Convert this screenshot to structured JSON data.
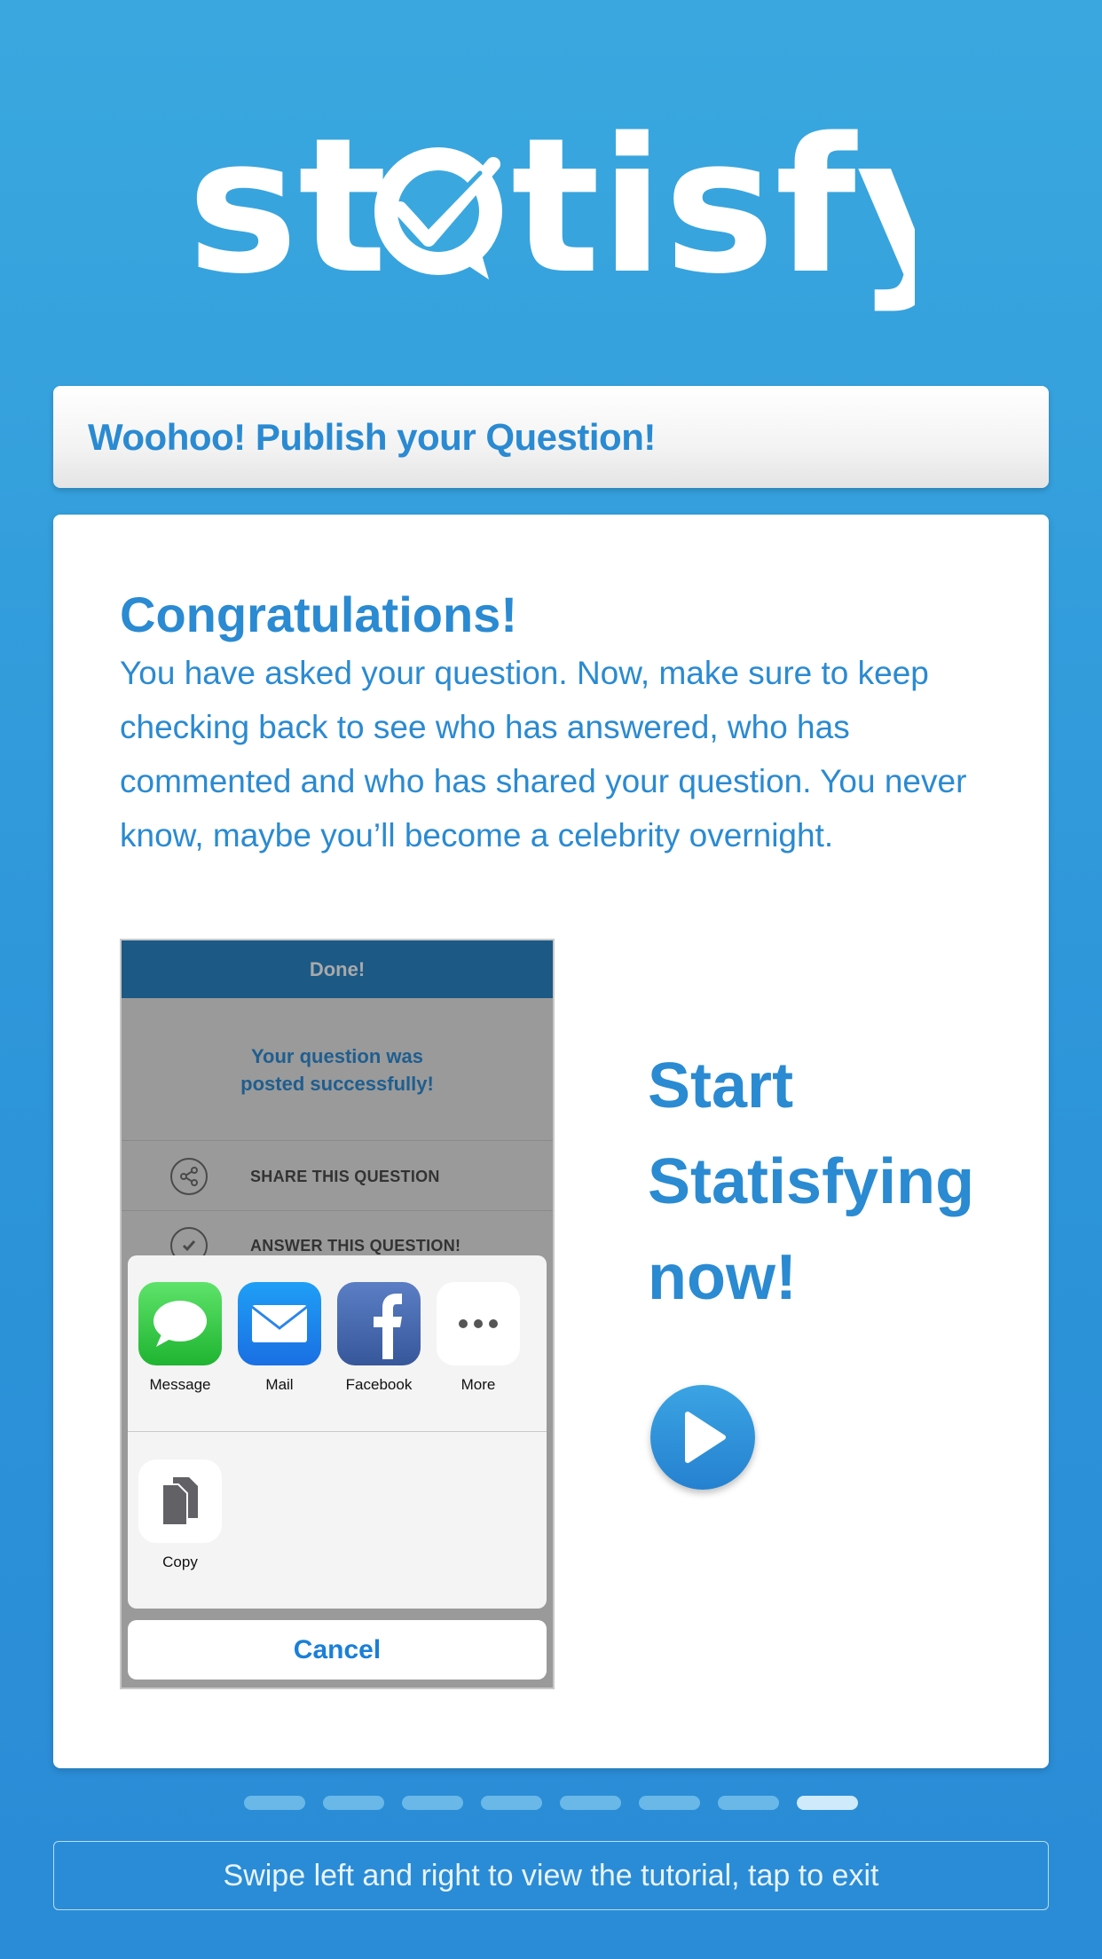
{
  "brand": {
    "logo_text": "statisfy",
    "icon": "check-speech-bubble-icon"
  },
  "header": {
    "title": "Woohoo! Publish your Question!"
  },
  "card": {
    "heading": "Congratulations!",
    "body": "You have asked your question. Now, make sure to keep checking back to see who has answered, who has commented and who has shared your question. You never know, maybe you’ll become a celebrity overnight."
  },
  "mockup": {
    "nav_title": "Done!",
    "message_line1": "Your question was",
    "message_line2": "posted successfully!",
    "rows": [
      {
        "label": "SHARE THIS QUESTION",
        "icon": "share-icon"
      },
      {
        "label": "ANSWER THIS QUESTION!",
        "icon": "check-circle-icon"
      }
    ],
    "share_apps": [
      {
        "label": "Message",
        "icon": "message-icon"
      },
      {
        "label": "Mail",
        "icon": "mail-icon"
      },
      {
        "label": "Facebook",
        "icon": "facebook-icon"
      },
      {
        "label": "More",
        "icon": "more-icon"
      }
    ],
    "share_actions": [
      {
        "label": "Copy",
        "icon": "copy-icon"
      }
    ],
    "cancel_label": "Cancel"
  },
  "cta": {
    "line1": "Start",
    "line2": "Statisfying",
    "line3": "now!",
    "button_icon": "play-icon"
  },
  "pagination": {
    "total": 8,
    "current": 8
  },
  "footer": {
    "hint": "Swipe left and right to view the tutorial, tap to exit"
  },
  "colors": {
    "background": "#3aa8df",
    "accent": "#2a8ad2",
    "white": "#ffffff"
  }
}
